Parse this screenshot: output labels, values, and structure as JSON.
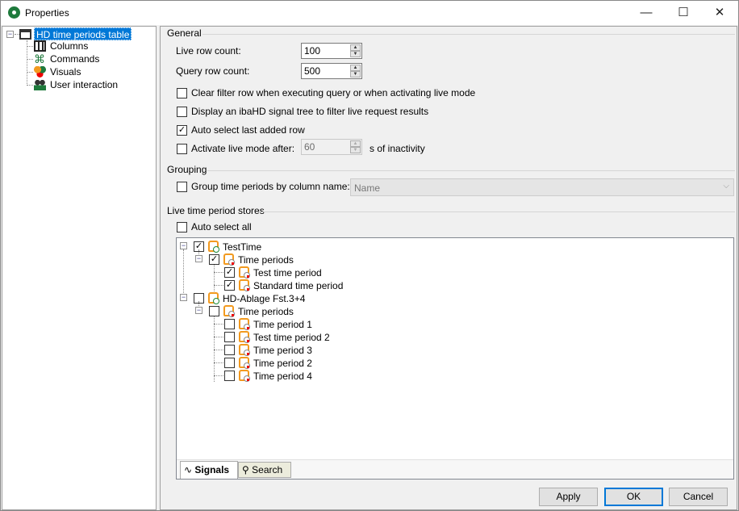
{
  "window": {
    "title": "Properties",
    "minimize": "—",
    "maximize": "☐",
    "close": "✕"
  },
  "nav": {
    "root": "HD time periods table",
    "items": [
      {
        "label": "Columns",
        "icon": "columns-icon"
      },
      {
        "label": "Commands",
        "icon": "command-icon"
      },
      {
        "label": "Visuals",
        "icon": "visuals-icon"
      },
      {
        "label": "User interaction",
        "icon": "users-icon"
      }
    ]
  },
  "general": {
    "title": "General",
    "live_row_count_label": "Live row count:",
    "live_row_count": "100",
    "query_row_count_label": "Query row count:",
    "query_row_count": "500",
    "clear_filter": {
      "label": "Clear filter row when executing query or when activating live mode",
      "checked": false
    },
    "signal_tree": {
      "label": "Display an ibaHD signal tree to filter live request results",
      "checked": false
    },
    "auto_select_last": {
      "label": "Auto select last added row",
      "checked": true
    },
    "activate_live": {
      "label": "Activate live mode after:",
      "checked": false,
      "value": "60",
      "suffix": "s of inactivity"
    }
  },
  "grouping": {
    "title": "Grouping",
    "label": "Group time periods by column name:",
    "checked": false,
    "selected": "Name"
  },
  "stores": {
    "title": "Live time period stores",
    "auto_select_all": "Auto select all",
    "auto_select_checked": false,
    "tree": [
      {
        "label": "TestTime",
        "level": 1,
        "checked": true,
        "expander": "-"
      },
      {
        "label": "Time periods",
        "level": 2,
        "checked": true,
        "expander": "-"
      },
      {
        "label": "Test time period",
        "level": 3,
        "checked": true
      },
      {
        "label": "Standard time period",
        "level": 3,
        "checked": true
      },
      {
        "label": "HD-Ablage Fst.3+4",
        "level": 1,
        "checked": false,
        "expander": "-"
      },
      {
        "label": "Time periods",
        "level": 2,
        "checked": false,
        "expander": "-"
      },
      {
        "label": "Time period 1",
        "level": 3,
        "checked": false
      },
      {
        "label": "Test time period 2",
        "level": 3,
        "checked": false
      },
      {
        "label": "Time period 3",
        "level": 3,
        "checked": false
      },
      {
        "label": "Time period 2",
        "level": 3,
        "checked": false
      },
      {
        "label": "Time period 4",
        "level": 3,
        "checked": false
      }
    ],
    "tabs": [
      {
        "label": "Signals",
        "active": true
      },
      {
        "label": "Search",
        "active": false
      }
    ]
  },
  "buttons": {
    "apply": "Apply",
    "ok": "OK",
    "cancel": "Cancel"
  },
  "colors": {
    "selection": "#0078d7",
    "accent_orange": "#f29a1f"
  }
}
